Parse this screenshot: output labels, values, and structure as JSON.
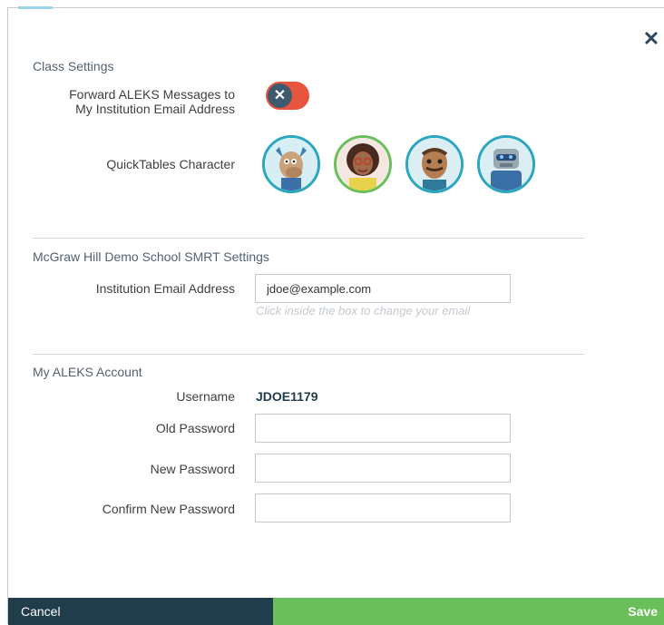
{
  "dialog": {
    "close_icon": "close-icon"
  },
  "class_settings": {
    "title": "Class Settings",
    "forward_label_line1": "Forward ALEKS Messages to",
    "forward_label_line2": "My Institution Email Address",
    "forward_enabled": false,
    "quicktables_label": "QuickTables Character",
    "characters": [
      "moose-character",
      "woman-character",
      "mustache-man-character",
      "robot-character"
    ],
    "selected_character_index": 1
  },
  "institution": {
    "title": "McGraw Hill Demo School SMRT Settings",
    "email_label": "Institution Email Address",
    "email_value": "jdoe@example.com",
    "email_hint": "Click inside the box to change your email"
  },
  "account": {
    "title": "My ALEKS Account",
    "username_label": "Username",
    "username_value": "JDOE1179",
    "old_password_label": "Old Password",
    "new_password_label": "New Password",
    "confirm_password_label": "Confirm New Password"
  },
  "footer": {
    "cancel_label": "Cancel",
    "save_label": "Save"
  },
  "colors": {
    "toggle_off": "#e8553f",
    "cancel_bg": "#203d4c",
    "save_bg": "#6abf5a",
    "avatar_ring": "#2aa6bf"
  }
}
